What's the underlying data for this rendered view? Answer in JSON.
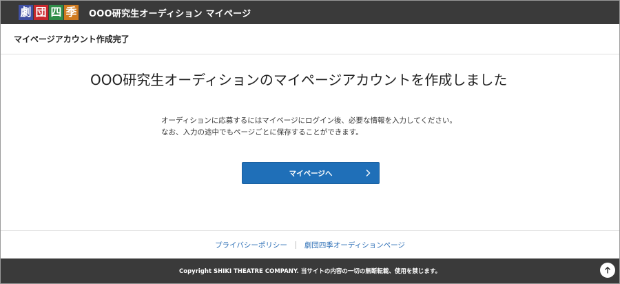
{
  "colors": {
    "header_bg": "#3a3a3a",
    "accent_button": "#1f6fb8",
    "link": "#2d6fb6",
    "logo": [
      "#3f4fa2",
      "#c8282d",
      "#2f8c48",
      "#d07a1e"
    ]
  },
  "header": {
    "logo_chars": [
      "劇",
      "団",
      "四",
      "季"
    ],
    "title": "OOO研究生オーディション マイページ"
  },
  "subheader": {
    "title": "マイページアカウント作成完了"
  },
  "main": {
    "heading": "OOO研究生オーディションのマイページアカウントを作成しました",
    "desc_line1": "オーディションに応募するにはマイページにログイン後、必要な情報を入力してください。",
    "desc_line2": "なお、入力の途中でもページごとに保存することができます。",
    "button_label": "マイページへ",
    "button_icon": "chevron-right-icon"
  },
  "footer": {
    "links": [
      "プライバシーポリシー",
      "劇団四季オーディションページ"
    ],
    "copyright": "Copyright SHIKI THEATRE COMPANY. 当サイトの内容の一切の無断転載、使用を禁じます。",
    "to_top_icon": "arrow-up-icon"
  }
}
